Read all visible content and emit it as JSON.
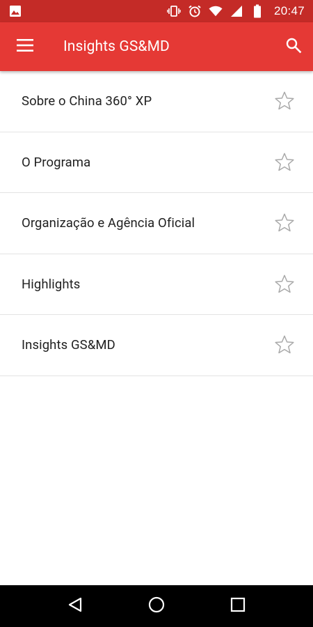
{
  "status_bar": {
    "time": "20:47",
    "icons": [
      "image-notification-icon",
      "vibrate-icon",
      "alarm-icon",
      "wifi-icon",
      "signal-icon",
      "battery-icon"
    ]
  },
  "app_bar": {
    "title": "Insights GS&MD",
    "menu_icon": "hamburger-menu-icon",
    "search_icon": "search-icon",
    "color": "#e53935"
  },
  "list": {
    "items": [
      {
        "label": "Sobre o China 360° XP",
        "favorite": false
      },
      {
        "label": "O Programa",
        "favorite": false
      },
      {
        "label": "Organização e Agência Oficial",
        "favorite": false
      },
      {
        "label": "Highlights",
        "favorite": false
      },
      {
        "label": "Insights GS&MD",
        "favorite": false
      }
    ]
  },
  "nav_bar": {
    "buttons": [
      "back-icon",
      "home-icon",
      "recents-icon"
    ]
  }
}
